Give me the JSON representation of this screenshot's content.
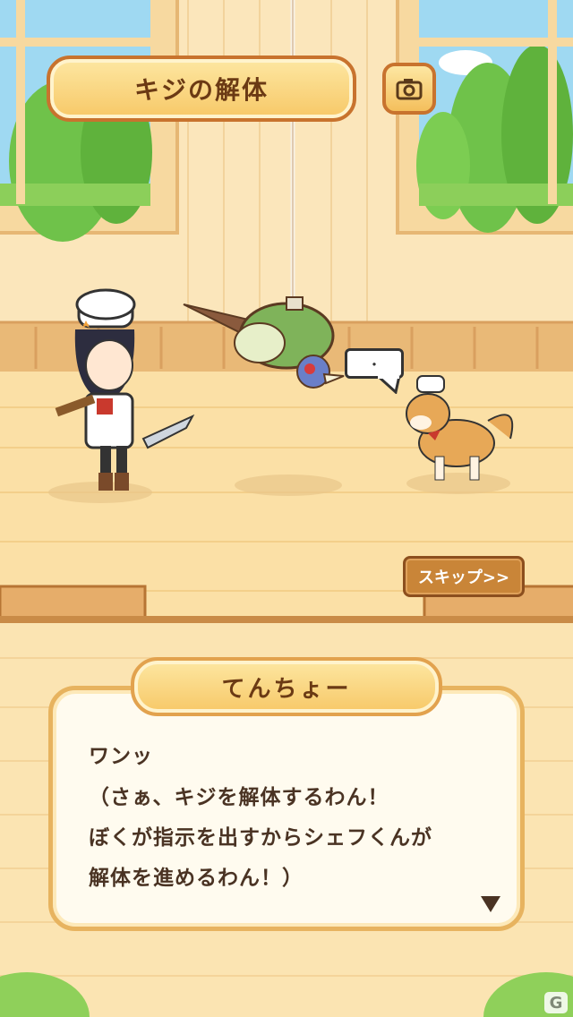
{
  "header": {
    "title": "キジの解体"
  },
  "scene": {
    "speech_bubble_text": "・"
  },
  "controls": {
    "skip_label": "スキップ>>"
  },
  "dialog": {
    "speaker": "てんちょー",
    "lines": [
      "ワンッ",
      "（さぁ、キジを解体するわん！",
      "ぼくが指示を出すからシェフくんが",
      "解体を進めるわん！）"
    ]
  },
  "watermark": {
    "text": "G"
  },
  "icons": {
    "camera": "camera-icon",
    "advance": "triangle-down-icon"
  },
  "colors": {
    "plate_fill": "#f7c867",
    "plate_border": "#c8732e",
    "text_brown": "#6b3a14",
    "wood_floor": "#fbe0a6"
  }
}
